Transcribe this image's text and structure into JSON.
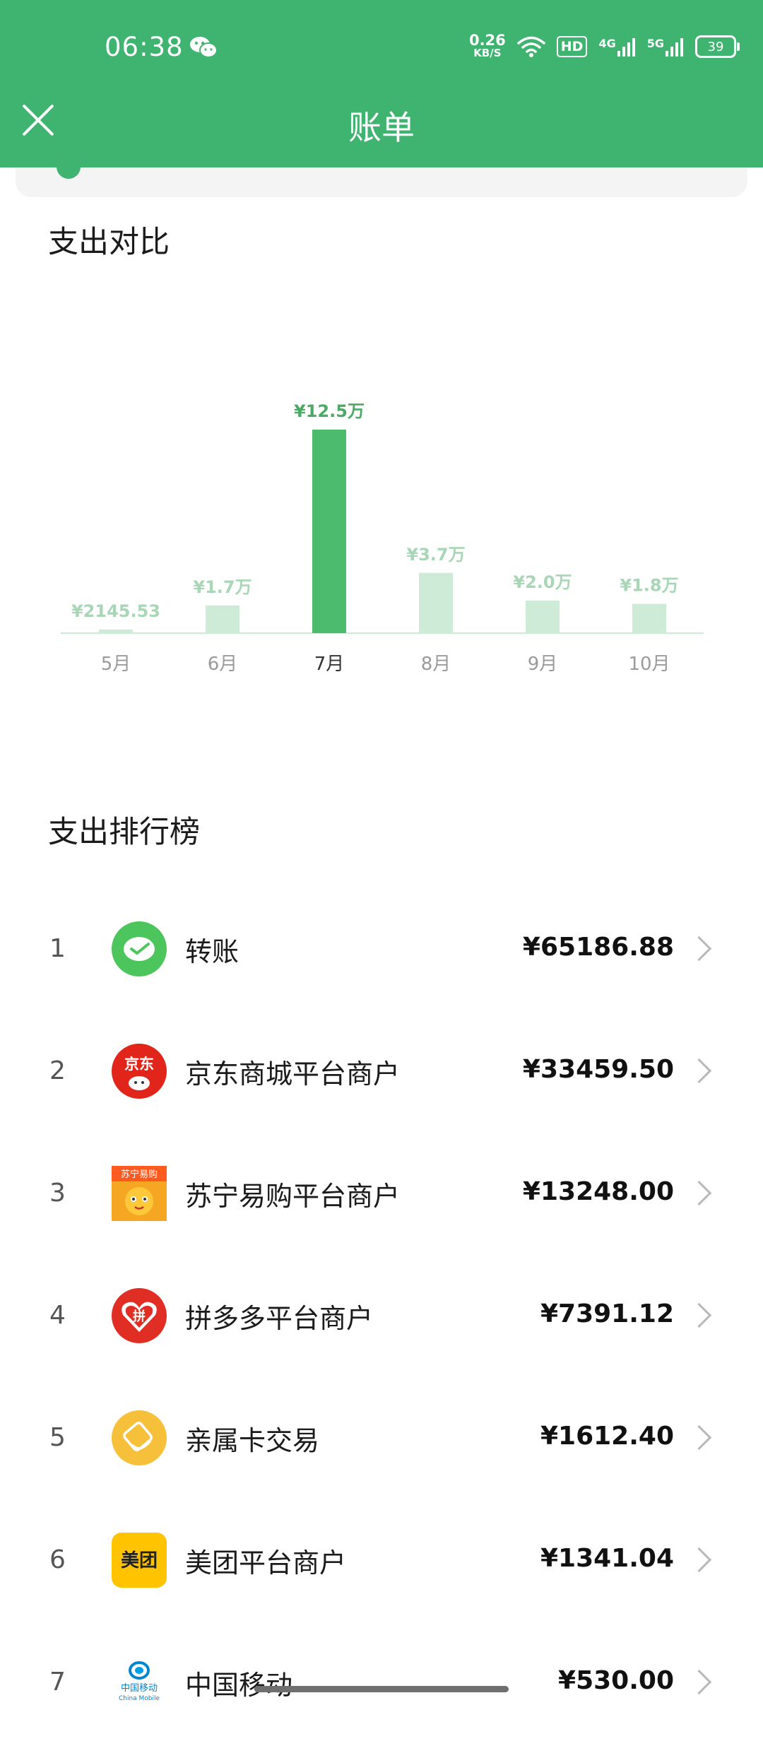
{
  "status_bar": {
    "time": "06:38",
    "net_speed_value": "0.26",
    "net_speed_unit": "KB/S",
    "hd_label": "HD",
    "network_4g": "4G",
    "network_5g": "5G",
    "battery": "39"
  },
  "header": {
    "title": "账单"
  },
  "expense_compare": {
    "title": "支出对比"
  },
  "chart_data": {
    "type": "bar",
    "categories": [
      "5月",
      "6月",
      "7月",
      "8月",
      "9月",
      "10月"
    ],
    "values": [
      2145.53,
      17000,
      125000,
      37000,
      20000,
      18000
    ],
    "value_labels": [
      "¥2145.53",
      "¥1.7万",
      "¥12.5万",
      "¥3.7万",
      "¥2.0万",
      "¥1.8万"
    ],
    "highlighted_index": 2,
    "colors": {
      "highlight_bar": "#4dbb6d",
      "normal_bar": "#cdebd7",
      "highlight_label": "#4aaa66",
      "normal_label": "#a8d6b6",
      "baseline": "#cdebd7",
      "highlight_tick": "#333333",
      "normal_tick": "#9a9a9a"
    }
  },
  "ranking": {
    "title": "支出排行榜",
    "items": [
      {
        "rank": "1",
        "name": "转账",
        "amount": "¥65186.88",
        "icon": "wechat-transfer-icon"
      },
      {
        "rank": "2",
        "name": "京东商城平台商户",
        "amount": "¥33459.50",
        "icon": "jd-logo-icon",
        "icon_text": "京东"
      },
      {
        "rank": "3",
        "name": "苏宁易购平台商户",
        "amount": "¥13248.00",
        "icon": "suning-logo-icon",
        "icon_text": "苏宁易购"
      },
      {
        "rank": "4",
        "name": "拼多多平台商户",
        "amount": "¥7391.12",
        "icon": "pinduoduo-logo-icon",
        "icon_text": "拼"
      },
      {
        "rank": "5",
        "name": "亲属卡交易",
        "amount": "¥1612.40",
        "icon": "family-card-icon"
      },
      {
        "rank": "6",
        "name": "美团平台商户",
        "amount": "¥1341.04",
        "icon": "meituan-logo-icon",
        "icon_text": "美团"
      },
      {
        "rank": "7",
        "name": "中国移动",
        "amount": "¥530.00",
        "icon": "china-mobile-logo-icon",
        "icon_text": "中国移动",
        "icon_subtext": "China Mobile"
      }
    ]
  }
}
